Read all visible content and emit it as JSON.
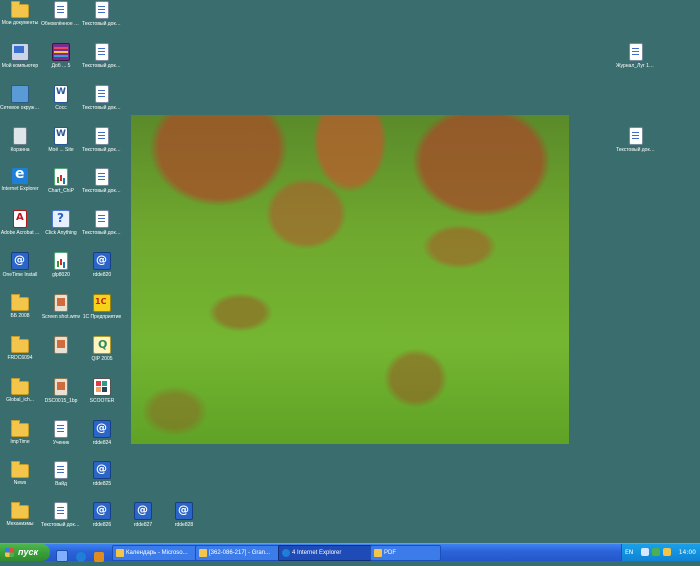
{
  "desktop": {
    "icons": [
      {
        "label": "Мои документы",
        "icon": "my-documents-icon"
      },
      {
        "label": "Мой компьютер",
        "icon": "my-computer-icon"
      },
      {
        "label": "Сетевое окружение",
        "icon": "network-places-icon"
      },
      {
        "label": "Корзина",
        "icon": "recycle-bin-icon"
      },
      {
        "label": "Internet Explorer",
        "icon": "internet-explorer-icon"
      },
      {
        "label": "Adobe Acrobat ...",
        "icon": "adobe-acrobat-icon"
      },
      {
        "label": "OneTime Install",
        "icon": "app-icon"
      },
      {
        "label": "ББ 2008",
        "icon": "folder-icon"
      },
      {
        "label": "FRDC6094",
        "icon": "folder-icon"
      },
      {
        "label": "Global_ich...",
        "icon": "folder-icon"
      },
      {
        "label": "ImpTime",
        "icon": "folder-icon"
      },
      {
        "label": "News",
        "icon": "folder-icon"
      },
      {
        "label": "Механизмы",
        "icon": "folder-icon"
      },
      {
        "label": "Обновлённое меню",
        "icon": "document-icon"
      },
      {
        "label": "Доб ... 5",
        "icon": "winrar-icon"
      },
      {
        "label": "Сосс",
        "icon": "word-document-icon"
      },
      {
        "label": "Моё ... Site",
        "icon": "word-document-icon"
      },
      {
        "label": "Chart_ChiP",
        "icon": "chart-icon"
      },
      {
        "label": "Click Anything",
        "icon": "search-icon"
      },
      {
        "label": "glp8020",
        "icon": "app-icon"
      },
      {
        "label": "Screen shot.wmv",
        "icon": "image-file-icon"
      },
      {
        "label": "",
        "icon": "image-file-icon"
      },
      {
        "label": "DSC0015_1bp",
        "icon": "image-file-icon"
      },
      {
        "label": "Ученик",
        "icon": "document-icon"
      },
      {
        "label": "Вайд",
        "icon": "document-icon"
      },
      {
        "label": "Текстовый документ",
        "icon": "document-icon"
      },
      {
        "label": "Текстовый документ (2)",
        "icon": "document-icon"
      },
      {
        "label": "Текстовый документ (3)",
        "icon": "document-icon"
      },
      {
        "label": "Текстовый документ (4)",
        "icon": "document-icon"
      },
      {
        "label": "Текстовый документ (5)",
        "icon": "document-icon"
      },
      {
        "label": "Текстовый документ (6)",
        "icon": "document-icon"
      },
      {
        "label": "Текстовый документ (7)",
        "icon": "document-icon"
      },
      {
        "label": "rdde820",
        "icon": "app-icon"
      },
      {
        "label": "1С Предприятие",
        "icon": "1c-icon"
      },
      {
        "label": "QIP 2005",
        "icon": "qip-icon"
      },
      {
        "label": "SCOOTER",
        "icon": "paint-icon"
      },
      {
        "label": "rdde824",
        "icon": "app-icon"
      },
      {
        "label": "rdde825",
        "icon": "app-icon"
      },
      {
        "label": "rdde826",
        "icon": "app-icon"
      },
      {
        "label": "rdde827",
        "icon": "app-icon"
      },
      {
        "label": "rdde828",
        "icon": "app-icon"
      },
      {
        "label": "Журнал_Луг 14.06",
        "icon": "document-icon"
      },
      {
        "label": "Текстовый документ (8)",
        "icon": "document-icon"
      }
    ],
    "wallpaper_name": "autumn-leaves-on-grass"
  },
  "taskbar": {
    "start_label": "пуск",
    "tasks": [
      {
        "label": "Календарь - Microso..."
      },
      {
        "label": "[362-086-217] - Gran..."
      },
      {
        "label": "4 Internet Explorer"
      },
      {
        "label": "PDF"
      }
    ],
    "tray": {
      "language": "EN",
      "clock": "14:00"
    }
  },
  "colors": {
    "desktop_bg": "#3a6e6e",
    "taskbar_blue": "#2458c9",
    "start_green": "#38a038"
  }
}
